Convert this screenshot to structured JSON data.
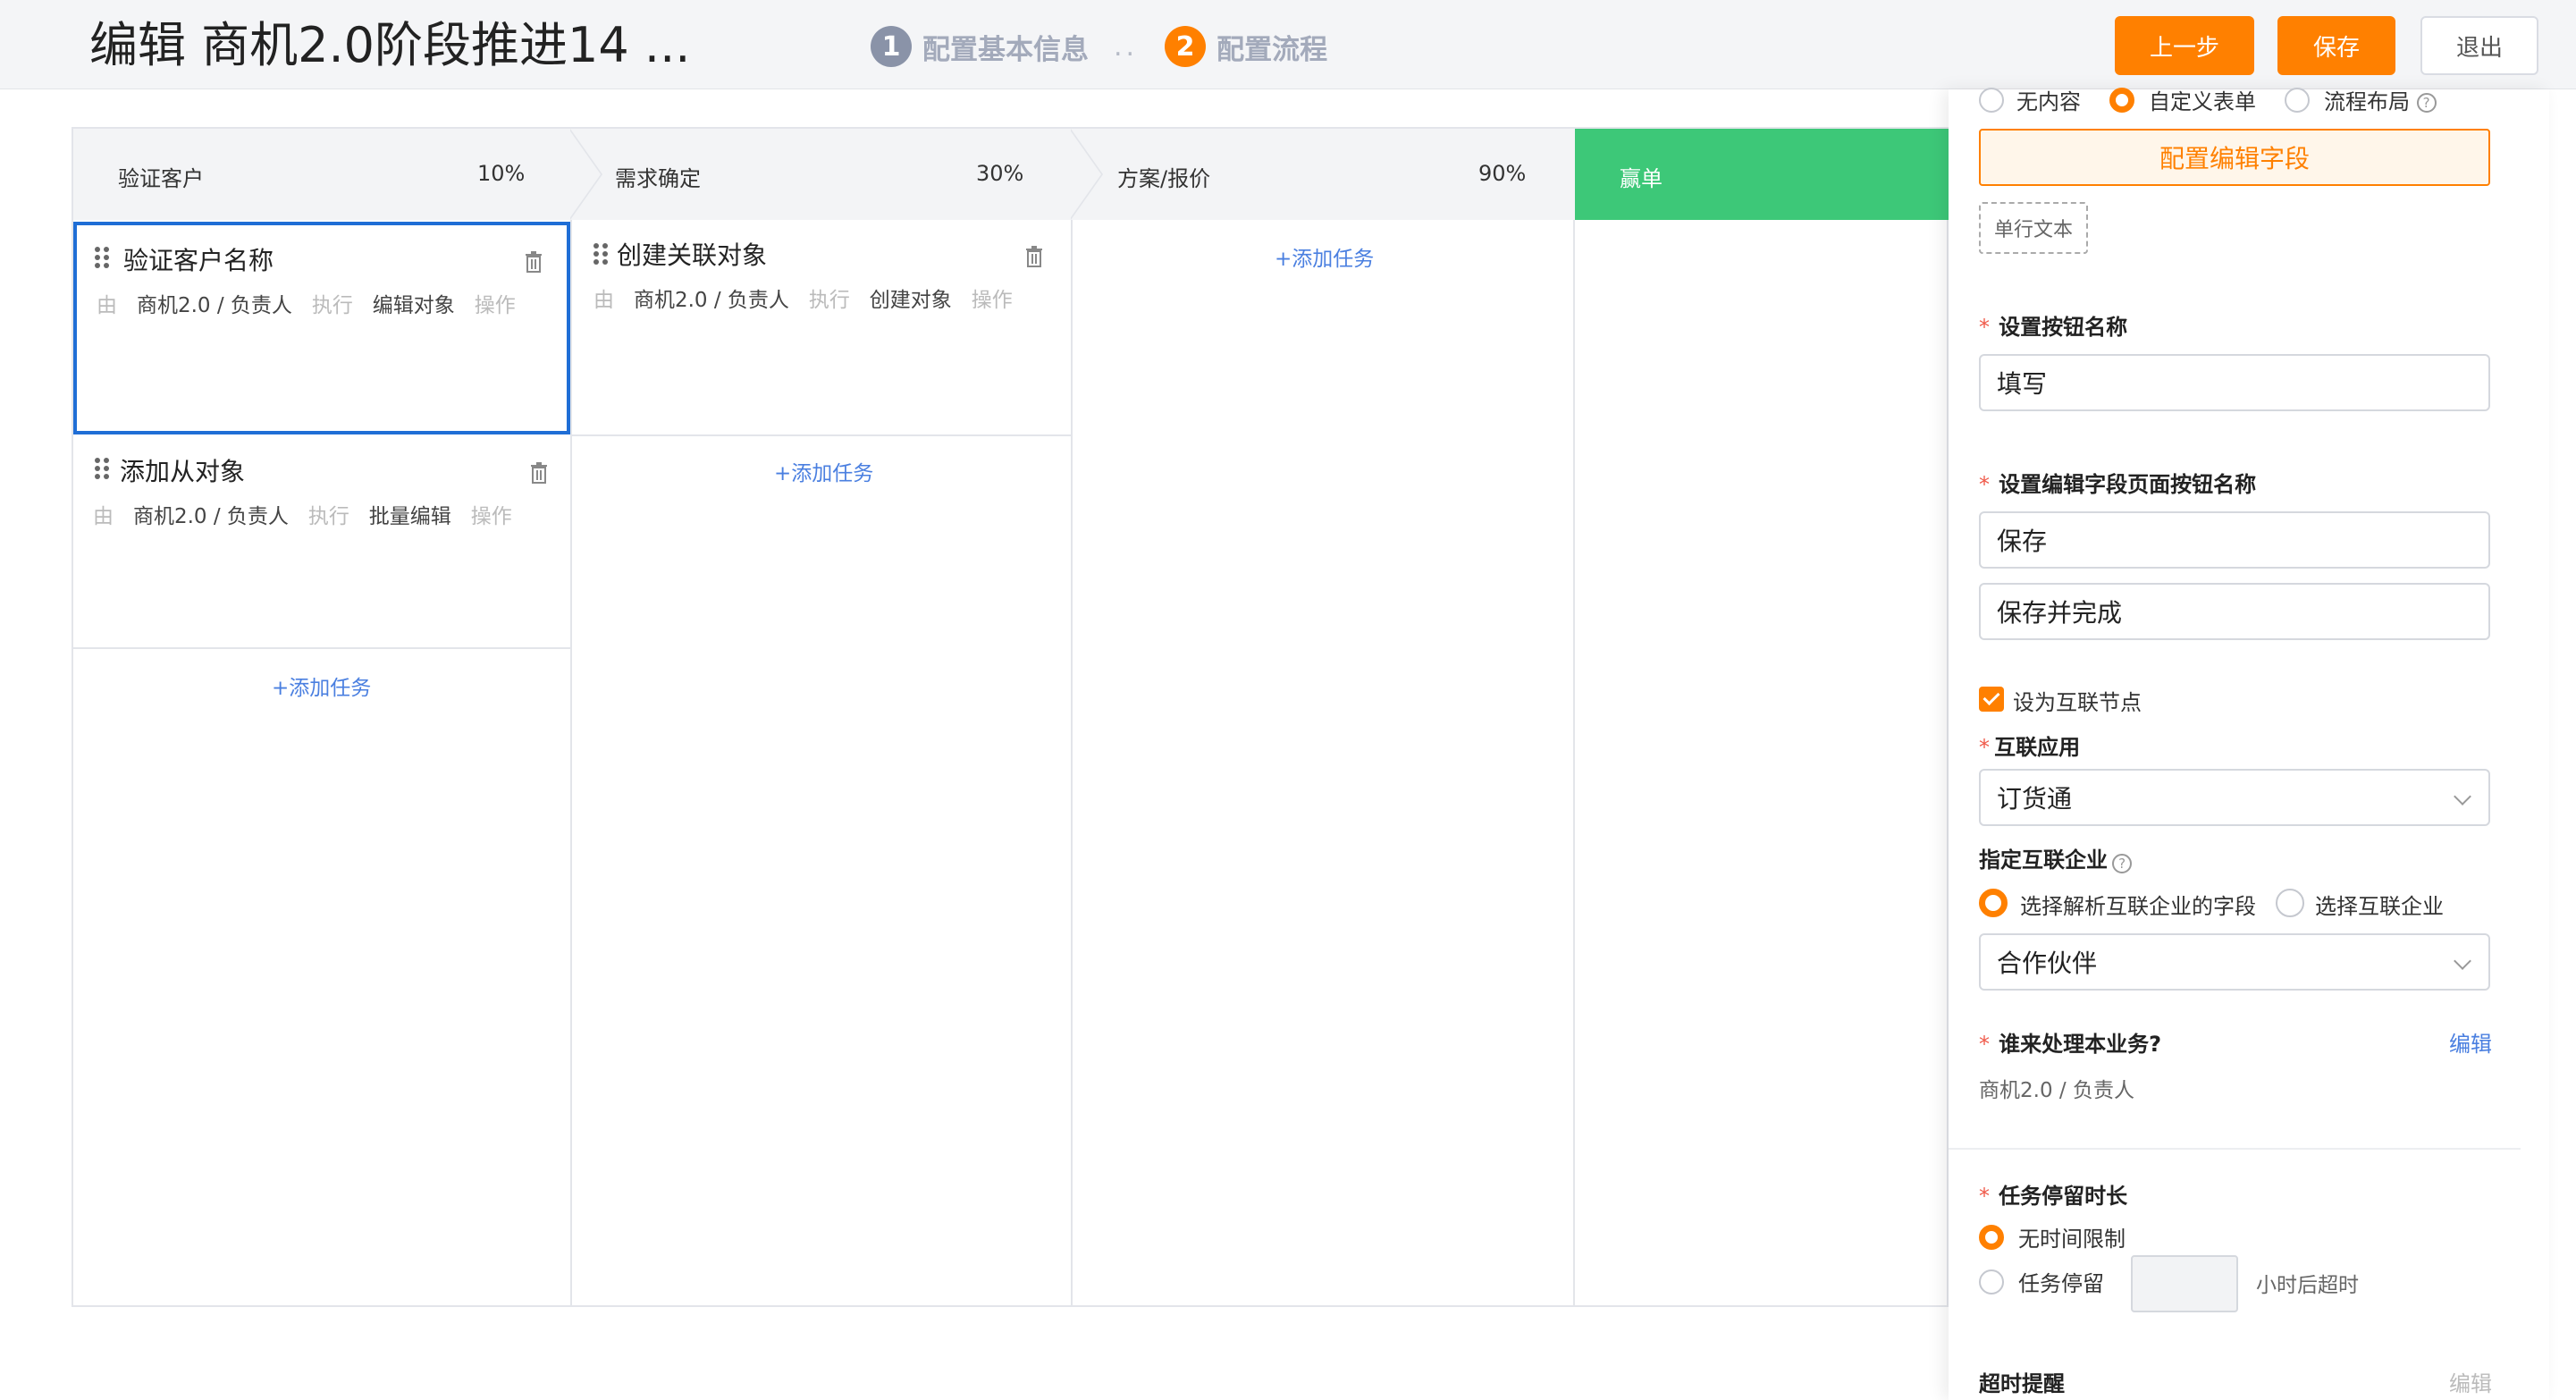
{
  "header": {
    "title": "编辑 商机2.0阶段推进14 ...",
    "steps": [
      {
        "num": "1",
        "label": "配置基本信息"
      },
      {
        "num": "2",
        "label": "配置流程"
      }
    ],
    "separator": "..",
    "prev_label": "上一步",
    "save_label": "保存",
    "exit_label": "退出"
  },
  "stages": [
    {
      "name": "验证客户",
      "percent": "10%"
    },
    {
      "name": "需求确定",
      "percent": "30%"
    },
    {
      "name": "方案/报价",
      "percent": "90%"
    },
    {
      "name": "赢单",
      "percent": ""
    }
  ],
  "tasks": [
    {
      "title": "验证客户名称",
      "by": "由",
      "owner": "商机2.0 / 负责人",
      "exec": "执行",
      "action": "编辑对象",
      "op": "操作"
    },
    {
      "title": "添加从对象",
      "by": "由",
      "owner": "商机2.0 / 负责人",
      "exec": "执行",
      "action": "批量编辑",
      "op": "操作"
    },
    {
      "title": "创建关联对象",
      "by": "由",
      "owner": "商机2.0 / 负责人",
      "exec": "执行",
      "action": "创建对象",
      "op": "操作"
    }
  ],
  "add_task_label": "+添加任务",
  "panel": {
    "content_options": [
      "无内容",
      "自定义表单",
      "流程布局"
    ],
    "config_fields_button": "配置编辑字段",
    "field_tag": "单行文本",
    "button_name_label": "设置按钮名称",
    "button_name_value": "填写",
    "edit_page_buttons_label": "设置编辑字段页面按钮名称",
    "edit_page_button_1": "保存",
    "edit_page_button_2": "保存并完成",
    "interconnect_node_label": "设为互联节点",
    "interconnect_app_label": "互联应用",
    "interconnect_app_value": "订货通",
    "interconnect_company_label": "指定互联企业",
    "company_options": [
      "选择解析互联企业的字段",
      "选择互联企业"
    ],
    "company_field_value": "合作伙伴",
    "handler_label": "谁来处理本业务?",
    "handler_edit": "编辑",
    "handler_value": "商机2.0 / 负责人",
    "stay_label": "任务停留时长",
    "stay_options": [
      "无时间限制",
      "任务停留"
    ],
    "stay_suffix": "小时后超时",
    "timeout_label": "超时提醒",
    "timeout_edit": "编辑",
    "help_glyph": "?"
  }
}
